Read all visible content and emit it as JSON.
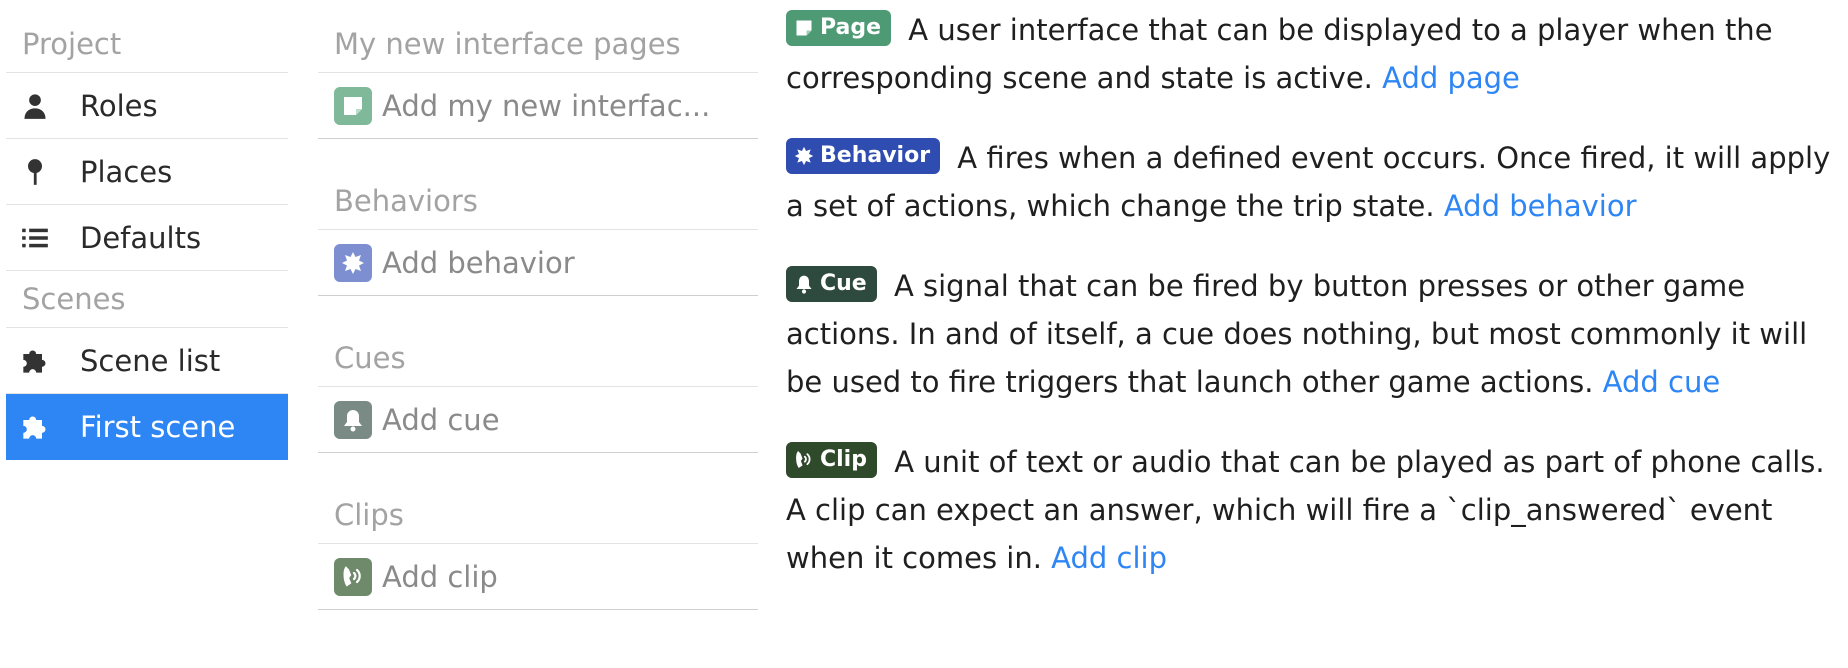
{
  "nav": {
    "project_header": "Project",
    "items_project": [
      {
        "label": "Roles",
        "icon": "user-icon"
      },
      {
        "label": "Places",
        "icon": "pin-icon"
      },
      {
        "label": "Defaults",
        "icon": "list-icon"
      }
    ],
    "scenes_header": "Scenes",
    "items_scenes": [
      {
        "label": "Scene list",
        "icon": "puzzle-icon"
      },
      {
        "label": "First scene",
        "icon": "puzzle-icon"
      }
    ],
    "active_color": "#2e86f5"
  },
  "middle": {
    "pages_header": "My new interface pages",
    "pages_add": "Add my new interfac...",
    "behaviors_header": "Behaviors",
    "behaviors_add": "Add behavior",
    "cues_header": "Cues",
    "cues_add": "Add cue",
    "clips_header": "Clips",
    "clips_add": "Add clip"
  },
  "descriptions": {
    "page": {
      "badge": "Page",
      "badge_color": "#4e9a75",
      "text": "A user interface that can be displayed to a player when the corresponding scene and state is active.",
      "link": "Add page"
    },
    "behavior": {
      "badge": "Behavior",
      "badge_color": "#2f4cb0",
      "text": "A fires when a defined event occurs. Once fired, it will apply a set of actions, which change the trip state.",
      "link": "Add behavior"
    },
    "cue": {
      "badge": "Cue",
      "badge_color": "#2e4a3e",
      "text": "A signal that can be fired by button presses or other game actions. In and of itself, a cue does nothing, but most commonly it will be used to fire triggers that launch other game actions.",
      "link": "Add cue"
    },
    "clip": {
      "badge": "Clip",
      "badge_color": "#2f4a2b",
      "text": "A unit of text or audio that can be played as part of phone calls. A clip can expect an answer, which will fire a `clip_answered` event when it comes in.",
      "link": "Add clip"
    }
  },
  "colors": {
    "link": "#2e86f5",
    "page_square": "#7fb99a",
    "behavior_square": "#7d8fd0",
    "cue_square": "#7a8a84",
    "clip_square": "#6f8a6b"
  }
}
